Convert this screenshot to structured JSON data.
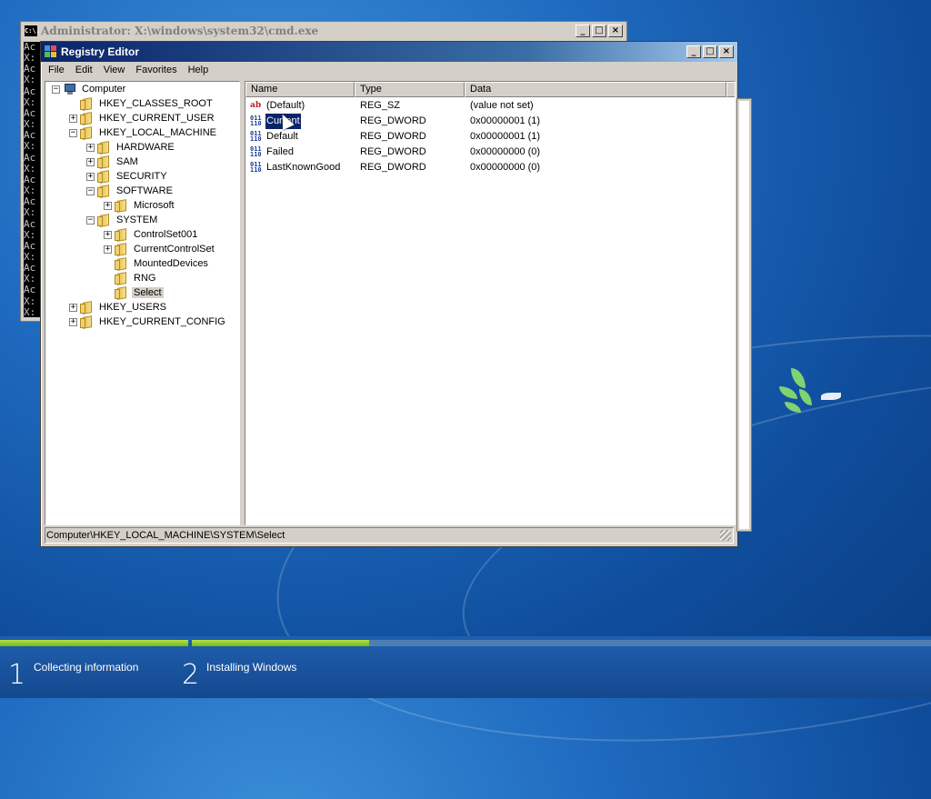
{
  "cmd": {
    "title": "Administrator: X:\\windows\\system32\\cmd.exe",
    "icon_text": "C:\\.",
    "console_lines": [
      "Ac",
      "X:",
      "Ac",
      "X:",
      "Ac",
      "X:",
      "Ac",
      "X:",
      "Ac",
      "X:",
      "Ac",
      "X:",
      "Ac",
      "X:",
      "Ac",
      "X:",
      "Ac",
      "X:",
      "Ac",
      "X:",
      "Ac",
      "X:",
      "Ac",
      "X:",
      "",
      "X:"
    ]
  },
  "regedit": {
    "title": "Registry Editor",
    "menu": [
      "File",
      "Edit",
      "View",
      "Favorites",
      "Help"
    ],
    "tree": [
      {
        "label": "Computer",
        "indent": 0,
        "expander": "−",
        "icon": "computer"
      },
      {
        "label": "HKEY_CLASSES_ROOT",
        "indent": 1,
        "expander": "",
        "icon": "folder"
      },
      {
        "label": "HKEY_CURRENT_USER",
        "indent": 1,
        "expander": "+",
        "icon": "folder"
      },
      {
        "label": "HKEY_LOCAL_MACHINE",
        "indent": 1,
        "expander": "−",
        "icon": "folder"
      },
      {
        "label": "HARDWARE",
        "indent": 2,
        "expander": "+",
        "icon": "folder"
      },
      {
        "label": "SAM",
        "indent": 2,
        "expander": "+",
        "icon": "folder"
      },
      {
        "label": "SECURITY",
        "indent": 2,
        "expander": "+",
        "icon": "folder"
      },
      {
        "label": "SOFTWARE",
        "indent": 2,
        "expander": "−",
        "icon": "folder"
      },
      {
        "label": "Microsoft",
        "indent": 3,
        "expander": "+",
        "icon": "folder"
      },
      {
        "label": "SYSTEM",
        "indent": 2,
        "expander": "−",
        "icon": "folder"
      },
      {
        "label": "ControlSet001",
        "indent": 3,
        "expander": "+",
        "icon": "folder"
      },
      {
        "label": "CurrentControlSet",
        "indent": 3,
        "expander": "+",
        "icon": "folder"
      },
      {
        "label": "MountedDevices",
        "indent": 3,
        "expander": "",
        "icon": "folder"
      },
      {
        "label": "RNG",
        "indent": 3,
        "expander": "",
        "icon": "folder"
      },
      {
        "label": "Select",
        "indent": 3,
        "expander": "",
        "icon": "folder",
        "selected": true
      },
      {
        "label": "HKEY_USERS",
        "indent": 1,
        "expander": "+",
        "icon": "folder"
      },
      {
        "label": "HKEY_CURRENT_CONFIG",
        "indent": 1,
        "expander": "+",
        "icon": "folder"
      }
    ],
    "columns": [
      "Name",
      "Type",
      "Data"
    ],
    "values": [
      {
        "name": "(Default)",
        "type": "REG_SZ",
        "data": "(value not set)",
        "icon": "string-value-icon"
      },
      {
        "name": "Current",
        "type": "REG_DWORD",
        "data": "0x00000001 (1)",
        "icon": "dword-value-icon",
        "selected": true
      },
      {
        "name": "Default",
        "type": "REG_DWORD",
        "data": "0x00000001 (1)",
        "icon": "dword-value-icon"
      },
      {
        "name": "Failed",
        "type": "REG_DWORD",
        "data": "0x00000000 (0)",
        "icon": "dword-value-icon"
      },
      {
        "name": "LastKnownGood",
        "type": "REG_DWORD",
        "data": "0x00000000 (0)",
        "icon": "dword-value-icon"
      }
    ],
    "status_path": "Computer\\HKEY_LOCAL_MACHINE\\SYSTEM\\Select"
  },
  "setup": {
    "steps": [
      {
        "number": "1",
        "label": "Collecting information",
        "progress": 1.0
      },
      {
        "number": "2",
        "label": "Installing Windows",
        "progress": 0.24
      }
    ]
  },
  "colors": {
    "desktop": "#1f6bc0",
    "titlebar_active": "#0a246a",
    "selection": "#0a246a",
    "progress_fill": "#6cbb1a"
  }
}
